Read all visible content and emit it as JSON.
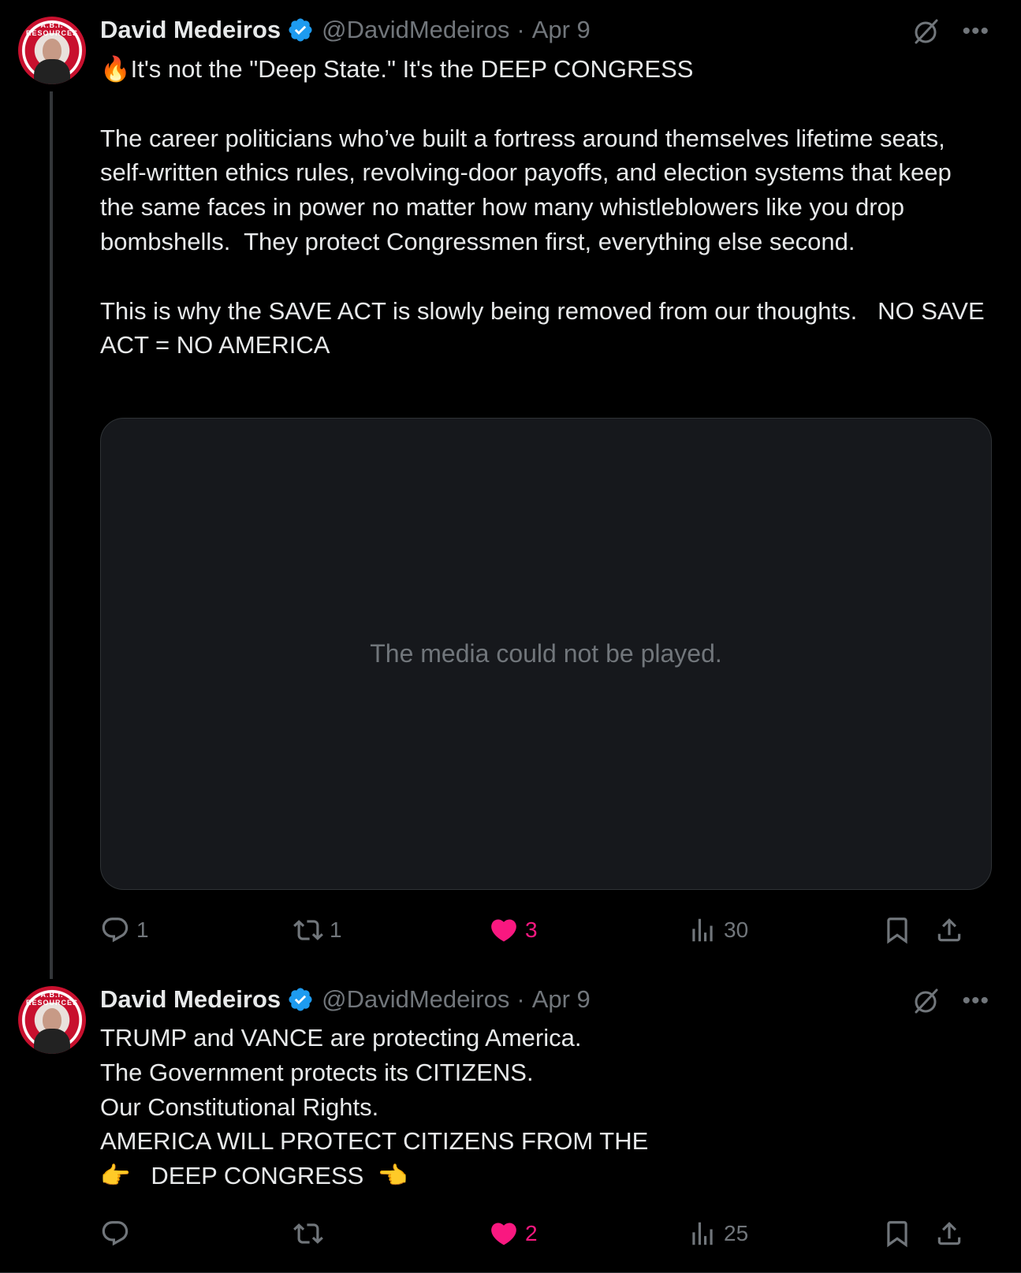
{
  "colors": {
    "background": "#000000",
    "text": "#e7e9ea",
    "muted": "#71767b",
    "like": "#f91880",
    "verified": "#1d9bf0"
  },
  "tweets": [
    {
      "author": {
        "name": "David Medeiros",
        "handle": "@DavidMedeiros",
        "verified_icon": "verified-badge-icon",
        "avatar_badge_text": "A.B.I. RESOURCES"
      },
      "separator": "·",
      "date": "Apr 9",
      "text": "🔥It's not the \"Deep State.\" It's the DEEP CONGRESS\n\nThe career politicians who’ve built a fortress around themselves lifetime seats, self-written ethics rules, revolving-door payoffs, and election systems that keep the same faces in power no matter how many whistleblowers like you drop bombshells.  They protect Congressmen first, everything else second.\n\nThis is why the SAVE ACT is slowly being removed from our thoughts.   NO SAVE ACT = NO AMERICA",
      "media_message": "The media could not be played.",
      "stats": {
        "replies": "1",
        "reposts": "1",
        "likes": "3",
        "views": "30"
      }
    },
    {
      "author": {
        "name": "David Medeiros",
        "handle": "@DavidMedeiros",
        "verified_icon": "verified-badge-icon",
        "avatar_badge_text": "A.B.I. RESOURCES"
      },
      "separator": "·",
      "date": "Apr 9",
      "text": "TRUMP and VANCE are protecting America.\nThe Government protects its CITIZENS.\nOur Constitutional Rights.\nAMERICA WILL PROTECT CITIZENS FROM THE\n👉   DEEP CONGRESS  👈",
      "stats": {
        "replies": "",
        "reposts": "",
        "likes": "2",
        "views": "25"
      }
    }
  ]
}
